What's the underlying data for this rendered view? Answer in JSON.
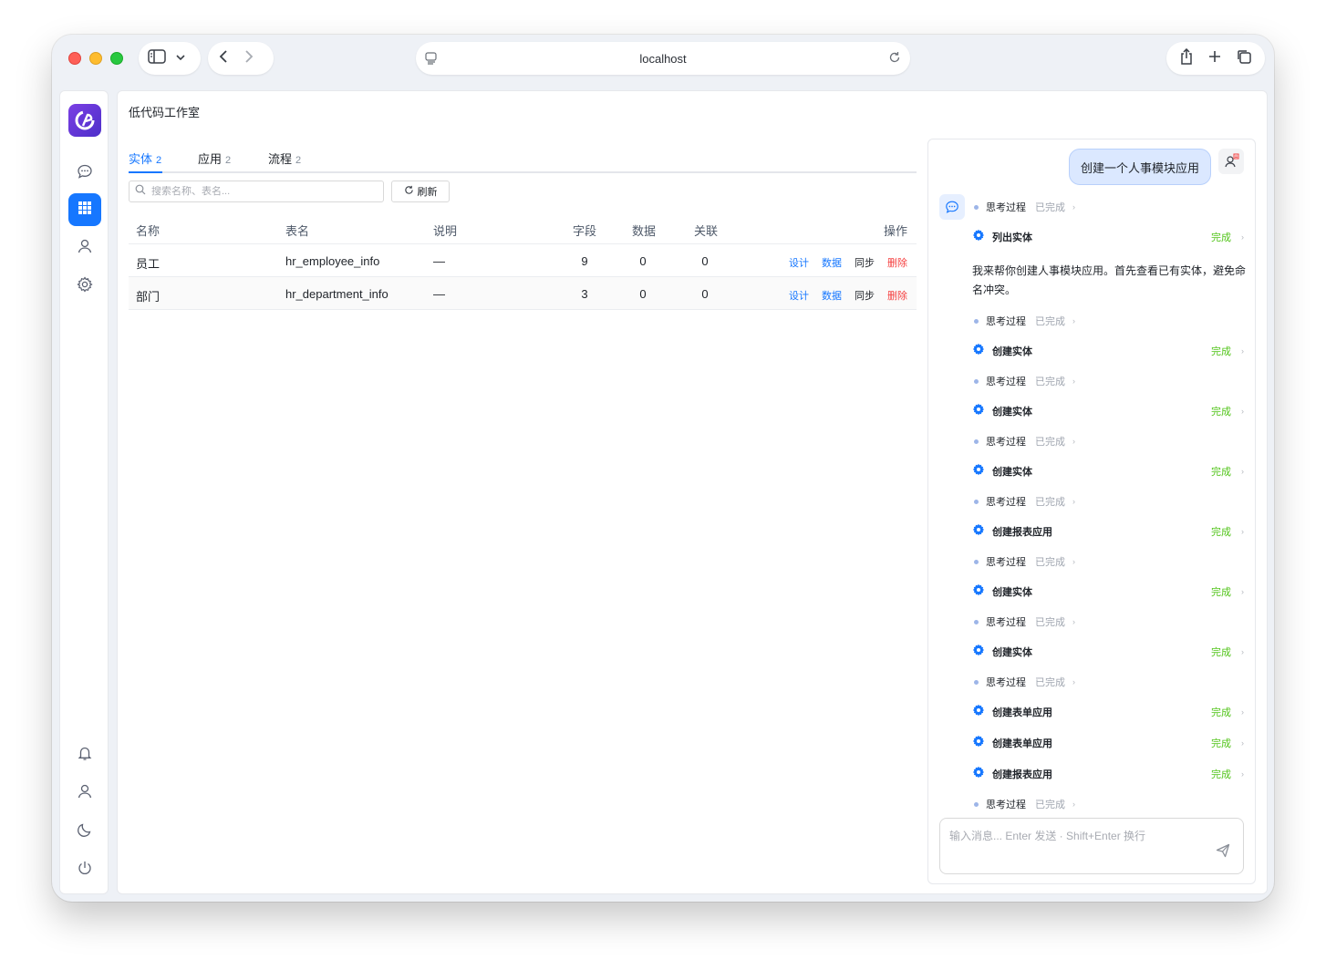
{
  "browser": {
    "url": "localhost"
  },
  "app": {
    "title": "低代码工作室"
  },
  "tabs": [
    {
      "label": "实体",
      "count": "2"
    },
    {
      "label": "应用",
      "count": "2"
    },
    {
      "label": "流程",
      "count": "2"
    }
  ],
  "search": {
    "placeholder": "搜索名称、表名...",
    "value": ""
  },
  "toolbar": {
    "refresh_label": "刷新"
  },
  "table": {
    "headers": {
      "name": "名称",
      "table_name": "表名",
      "description": "说明",
      "fields": "字段",
      "data": "数据",
      "relations": "关联",
      "actions": "操作"
    },
    "rows": [
      {
        "name": "员工",
        "table_name": "hr_employee_info",
        "description": "—",
        "fields": "9",
        "data": "0",
        "relations": "0"
      },
      {
        "name": "部门",
        "table_name": "hr_department_info",
        "description": "—",
        "fields": "3",
        "data": "0",
        "relations": "0"
      }
    ],
    "actions": {
      "design": "设计",
      "data": "数据",
      "sync": "同步",
      "delete": "删除"
    }
  },
  "chat": {
    "user_message": "创建一个人事模块应用",
    "assistant_text": "我来帮你创建人事模块应用。首先查看已有实体，避免命名冲突。",
    "think_label": "思考过程",
    "think_status": "已完成",
    "done_label": "完成",
    "items": [
      {
        "kind": "think"
      },
      {
        "kind": "tool",
        "label": "列出实体"
      },
      {
        "kind": "text"
      },
      {
        "kind": "think"
      },
      {
        "kind": "tool",
        "label": "创建实体"
      },
      {
        "kind": "think"
      },
      {
        "kind": "tool",
        "label": "创建实体"
      },
      {
        "kind": "think"
      },
      {
        "kind": "tool",
        "label": "创建实体"
      },
      {
        "kind": "think"
      },
      {
        "kind": "tool",
        "label": "创建报表应用"
      },
      {
        "kind": "think"
      },
      {
        "kind": "tool",
        "label": "创建实体"
      },
      {
        "kind": "think"
      },
      {
        "kind": "tool",
        "label": "创建实体"
      },
      {
        "kind": "think"
      },
      {
        "kind": "tool",
        "label": "创建表单应用"
      },
      {
        "kind": "tool",
        "label": "创建表单应用"
      },
      {
        "kind": "tool",
        "label": "创建报表应用"
      },
      {
        "kind": "think"
      }
    ],
    "input_placeholder": "输入消息... Enter 发送 · Shift+Enter 换行"
  },
  "colors": {
    "accent": "#1677ff",
    "success": "#52c41a",
    "danger": "#f53f3f"
  }
}
